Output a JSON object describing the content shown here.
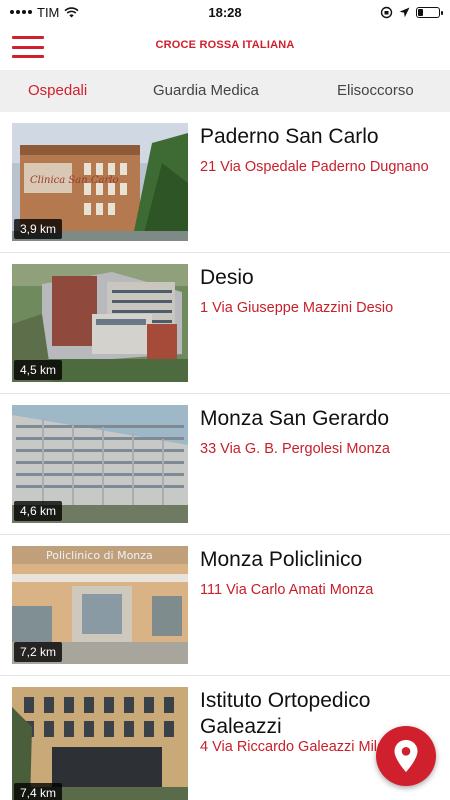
{
  "status_bar": {
    "carrier": "TIM",
    "time": "18:28",
    "battery_level": 0.25
  },
  "header": {
    "title": "CROCE ROSSA ITALIANA",
    "menu_icon": "hamburger-menu-icon",
    "accent_color": "#d01f2d"
  },
  "tabs": [
    {
      "label": "Ospedali",
      "active": true
    },
    {
      "label": "Guardia Medica",
      "active": false
    },
    {
      "label": "Elisoccorso",
      "active": false
    }
  ],
  "hospitals": [
    {
      "name": "Paderno San Carlo",
      "address": "21 Via Ospedale Paderno Dugnano",
      "distance": "3,9 km",
      "photo_sign": "Clinica San Carlo"
    },
    {
      "name": "Desio",
      "address": "1 Via Giuseppe Mazzini Desio",
      "distance": "4,5 km"
    },
    {
      "name": "Monza San Gerardo",
      "address": "33 Via G. B. Pergolesi Monza",
      "distance": "4,6 km"
    },
    {
      "name": "Monza Policlinico",
      "address": "111 Via Carlo Amati Monza",
      "distance": "7,2 km",
      "photo_sign": "Policlinico di Monza"
    },
    {
      "name": "Istituto Ortopedico Galeazzi",
      "address": "4 Via Riccardo Galeazzi Milano",
      "distance": "7,4 km"
    }
  ],
  "fab": {
    "icon": "map-pin-icon"
  }
}
